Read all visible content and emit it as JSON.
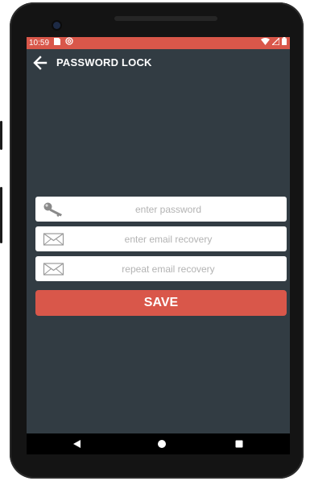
{
  "status_bar": {
    "time": "10:59",
    "left_icons": [
      "sim-card-icon",
      "at-sign-icon"
    ],
    "right_icons": [
      "wifi-icon",
      "signal-icon",
      "battery-icon"
    ],
    "color": "#d9574a"
  },
  "app_bar": {
    "title": "PASSWORD LOCK",
    "back_icon": "arrow-left-icon"
  },
  "form": {
    "password_placeholder": "enter password",
    "email_placeholder": "enter email recovery",
    "repeat_email_placeholder": "repeat email recovery",
    "password_icon": "key-icon",
    "email_icon": "envelope-icon",
    "repeat_email_icon": "envelope-icon",
    "save_label": "SAVE"
  },
  "nav_bar": {
    "buttons": [
      "back-triangle-icon",
      "home-circle-icon",
      "recents-square-icon"
    ]
  },
  "colors": {
    "accent": "#d9574a",
    "background": "#323c43",
    "field": "#ffffff"
  }
}
